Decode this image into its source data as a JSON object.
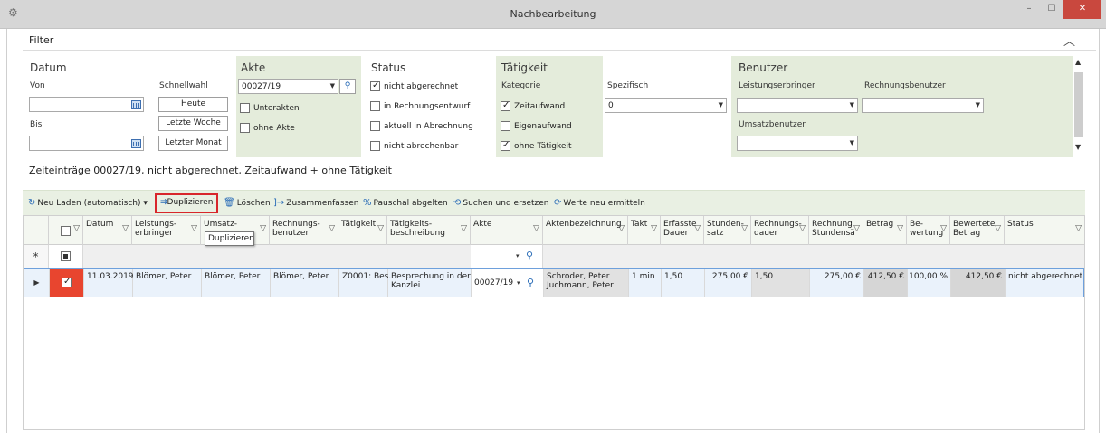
{
  "window": {
    "title": "Nachbearbeitung",
    "icon": "app-icon"
  },
  "filter": {
    "label": "Filter",
    "datum": {
      "title": "Datum",
      "von_label": "Von",
      "bis_label": "Bis",
      "von_value": "",
      "bis_value": ""
    },
    "schnellwahl": {
      "label": "Schnellwahl",
      "buttons": [
        "Heute",
        "Letzte Woche",
        "Letzter Monat"
      ]
    },
    "akte": {
      "title": "Akte",
      "value": "00027/19",
      "unterakten": "Unterakten",
      "ohne_akte": "ohne Akte"
    },
    "status": {
      "title": "Status",
      "items": [
        {
          "label": "nicht abgerechnet",
          "checked": true
        },
        {
          "label": "in Rechnungsentwurf",
          "checked": false
        },
        {
          "label": "aktuell in Abrechnung",
          "checked": false
        },
        {
          "label": "nicht abrechenbar",
          "checked": false
        }
      ]
    },
    "taetigkeit": {
      "title": "Tätigkeit",
      "kategorie_label": "Kategorie",
      "spezifisch_label": "Spezifisch",
      "spezifisch_value": "0",
      "items": [
        {
          "label": "Zeitaufwand",
          "checked": true
        },
        {
          "label": "Eigenaufwand",
          "checked": false
        },
        {
          "label": "ohne Tätigkeit",
          "checked": true
        }
      ]
    },
    "benutzer": {
      "title": "Benutzer",
      "leistungserbringer_label": "Leistungserbringer",
      "rechnungsbenutzer_label": "Rechnungsbenutzer",
      "umsatzbenutzer_label": "Umsatzbenutzer"
    }
  },
  "summary": "Zeiteinträge  00027/19, nicht abgerechnet, Zeitaufwand + ohne Tätigkeit",
  "toolbar": {
    "neu_laden": "Neu Laden (automatisch)",
    "duplizieren": "Duplizieren",
    "loeschen": "Löschen",
    "zusammenfassen": "Zusammenfassen",
    "pauschal": "Pauschal abgelten",
    "suchen": "Suchen und ersetzen",
    "werte": "Werte neu ermitteln"
  },
  "tooltip": "Duplizieren",
  "grid": {
    "headers": {
      "datum": "Datum",
      "leistungserbringer": [
        "Leistungs-",
        "erbringer"
      ],
      "umsatz": [
        "Umsatz-",
        ""
      ],
      "rechnungsbenutzer": [
        "Rechnungs-",
        "benutzer"
      ],
      "taetigkeit": "Tätigkeit",
      "beschreibung": [
        "Tätigkeits-",
        "beschreibung"
      ],
      "akte": "Akte",
      "aktenbezeichnung": "Aktenbezeichnung",
      "takt": "Takt",
      "erfasste_dauer": [
        "Erfasste",
        "Dauer"
      ],
      "stundensatz": [
        "Stunden-",
        "satz"
      ],
      "rechnungsdauer": [
        "Rechnungs-",
        "dauer"
      ],
      "rechnungsstundensatz": [
        "Rechnung",
        "Stundensä"
      ],
      "betrag": "Betrag",
      "bewertung": [
        "Be-",
        "wertung"
      ],
      "bewertete_betrag": [
        "Bewertete",
        "Betrag"
      ],
      "status": "Status"
    },
    "new_row_marker": "*",
    "row": {
      "datum": "11.03.2019",
      "leistungserbringer": "Blömer, Peter",
      "umsatz": "Blömer, Peter",
      "rechnungsbenutzer": "Blömer, Peter",
      "taetigkeit": "Z0001: Bes...",
      "beschreibung": [
        "Besprechung in der",
        "Kanzlei"
      ],
      "akte": "00027/19",
      "aktenbezeichnung": [
        "Schroder, Peter",
        "Juchmann, Peter"
      ],
      "takt": "1 min",
      "erfasste_dauer": "1,50",
      "stundensatz": "275,00 €",
      "rechnungsdauer": "1,50",
      "rechnungsstundensatz": "275,00 €",
      "betrag": "412,50 €",
      "bewertung": "100,00 %",
      "bewertete_betrag": "412,50 €",
      "status": "nicht abgerechnet"
    }
  }
}
